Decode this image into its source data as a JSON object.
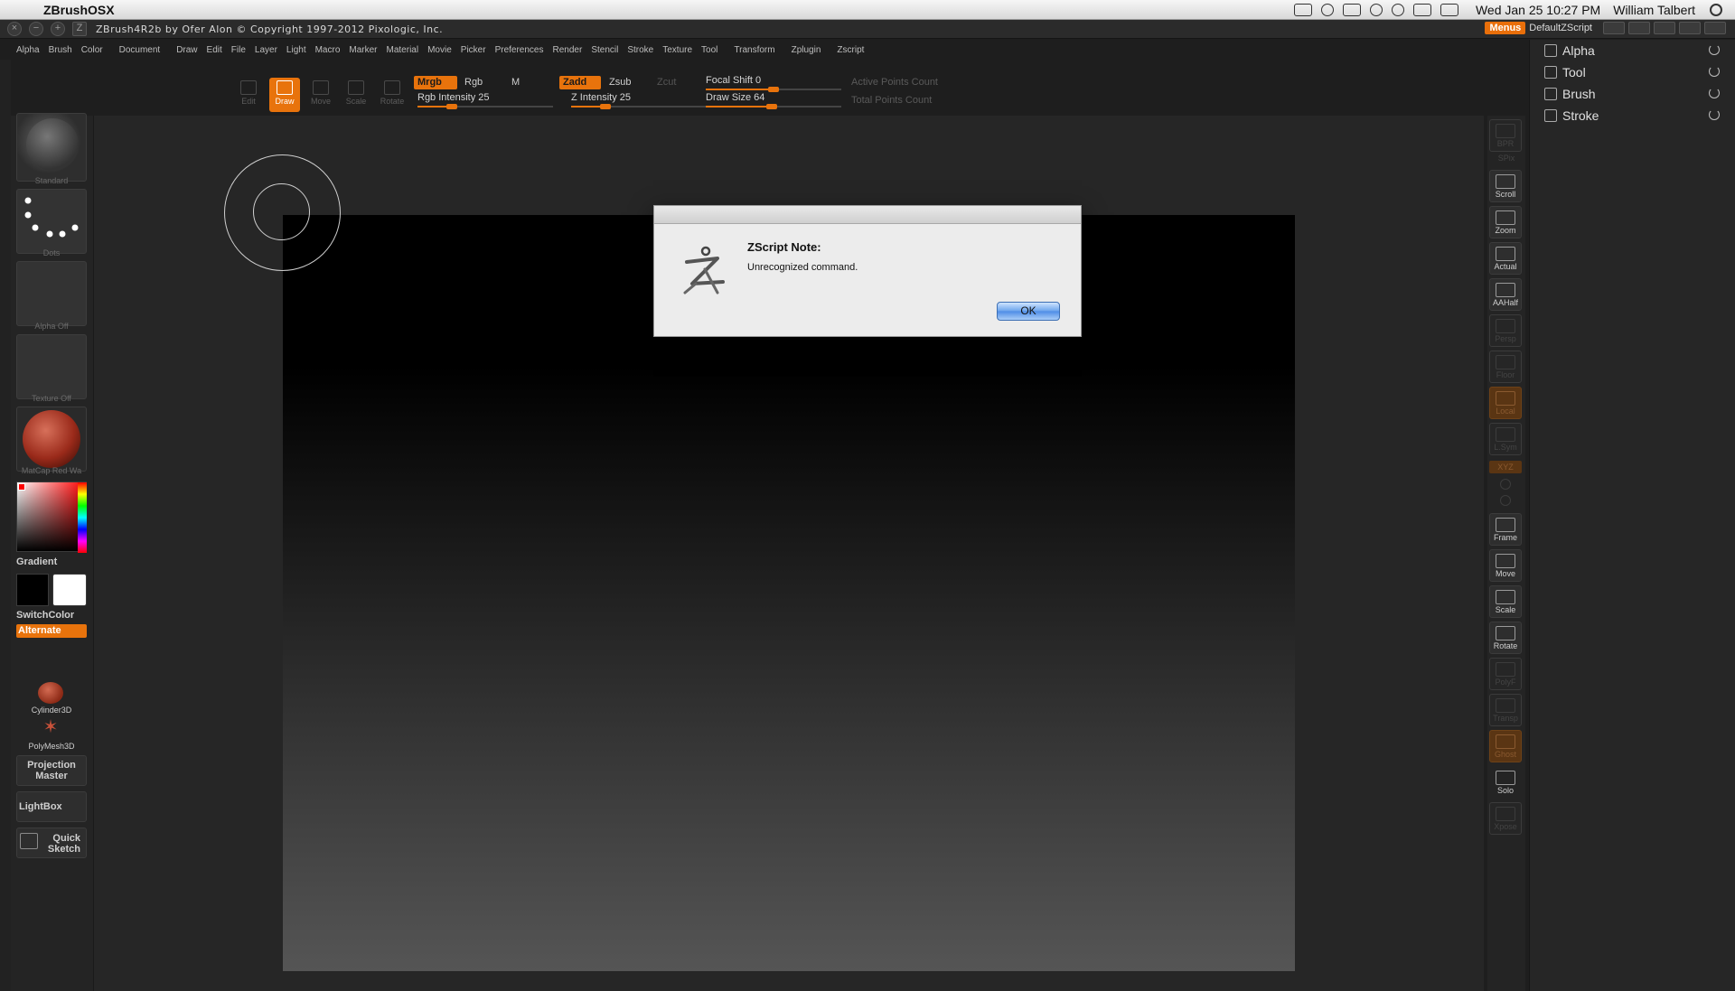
{
  "menubar": {
    "app_name": "ZBrushOSX",
    "clock": "Wed Jan 25  10:27 PM",
    "user": "William Talbert"
  },
  "zbrush_title": {
    "title": "ZBrush4R2b  by Ofer Alon © Copyright 1997-2012 Pixologic, Inc.",
    "menus_button": "Menus",
    "default_zscript": "DefaultZScript"
  },
  "zmenus": [
    "Alpha",
    "Brush",
    "Color",
    "Document",
    "Draw",
    "Edit",
    "File",
    "Layer",
    "Light",
    "Macro",
    "Marker",
    "Material",
    "Movie",
    "Picker",
    "Preferences",
    "Render",
    "Stencil",
    "Stroke",
    "Texture",
    "Tool",
    "Transform",
    "Zplugin",
    "Zscript"
  ],
  "toolbar": {
    "edit": "Edit",
    "draw": "Draw",
    "move": "Move",
    "scale": "Scale",
    "rotate": "Rotate",
    "mrgb": "Mrgb",
    "rgb": "Rgb",
    "m": "M",
    "zadd": "Zadd",
    "zsub": "Zsub",
    "zcut": "Zcut",
    "rgb_intensity": "Rgb Intensity 25",
    "z_intensity": "Z Intensity 25",
    "focal_shift": "Focal Shift 0",
    "draw_size": "Draw Size 64",
    "active_points": "Active Points Count",
    "total_points": "Total Points Count"
  },
  "leftshelf": {
    "brush": "Standard",
    "stroke": "Dots",
    "alpha": "Alpha  Off",
    "texture": "Texture  Off",
    "material": "MatCap  Red  Wa",
    "gradient": "Gradient",
    "switchcolor": "SwitchColor",
    "alternate": "Alternate",
    "tool1": "Cylinder3D",
    "tool2": "PolyMesh3D",
    "projection_master": "Projection Master",
    "lightbox": "LightBox",
    "quick_sketch": "Quick Sketch"
  },
  "rightshelf": {
    "bpr": "BPR",
    "spix": "SPix",
    "scroll": "Scroll",
    "zoom": "Zoom",
    "actual": "Actual",
    "aahalf": "AAHalf",
    "persp": "Persp",
    "floor": "Floor",
    "local": "Local",
    "lsym": "L.Sym",
    "xyz": "XYZ",
    "frame": "Frame",
    "move": "Move",
    "scale": "Scale",
    "rotate": "Rotate",
    "polyf": "PolyF",
    "transp": "Transp",
    "ghost": "Ghost",
    "solo": "Solo",
    "xpose": "Xpose"
  },
  "tray": {
    "items": [
      "Alpha",
      "Tool",
      "Brush",
      "Stroke"
    ]
  },
  "dialog": {
    "heading": "ZScript Note:",
    "message": "Unrecognized command.",
    "ok": "OK"
  },
  "colors": {
    "accent": "#e8730c",
    "primary_color": "#000000",
    "secondary_color": "#ffffff"
  }
}
